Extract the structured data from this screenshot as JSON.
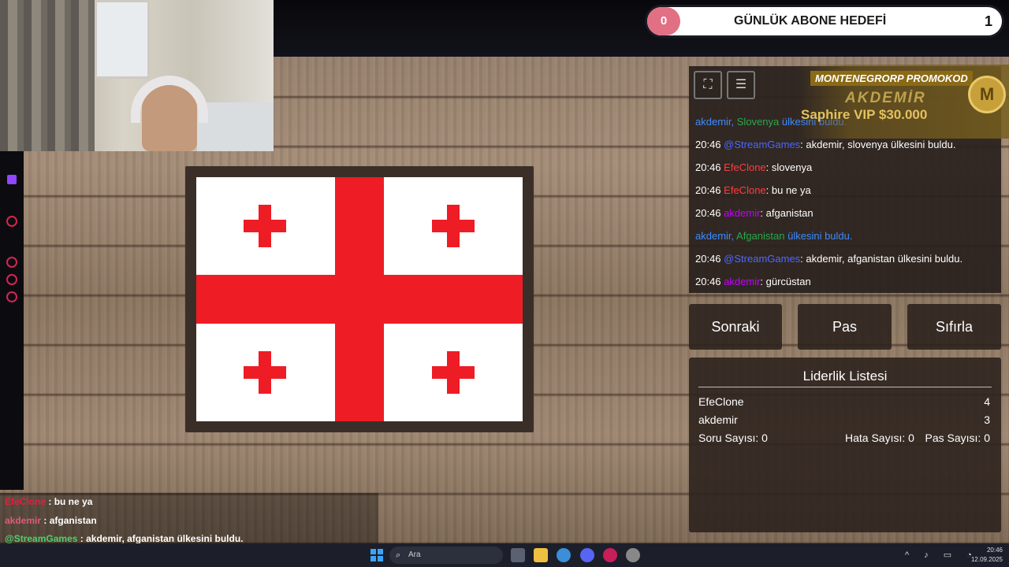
{
  "goal": {
    "count": "0",
    "title": "GÜNLÜK ABONE HEDEFİ",
    "target": "1"
  },
  "promo": {
    "label": "MONTENEGRORP PROMOKOD",
    "code": "AKDEMİR",
    "vip": "Saphire VIP $30.000",
    "badge": "M"
  },
  "chat": {
    "tools": [
      "expand-icon",
      "document-icon"
    ],
    "lines": [
      {
        "time": "",
        "user": "akdemir,",
        "user_color": "blue",
        "country": "Slovenya",
        "msg": "ülkesini buldu."
      },
      {
        "time": "20:46",
        "user": "@StreamGames",
        "user_color": "sg",
        "msg": ": akdemir, slovenya ülkesini buldu."
      },
      {
        "time": "20:46",
        "user": "EfeClone",
        "user_color": "red",
        "msg": ": slovenya"
      },
      {
        "time": "20:46",
        "user": "EfeClone",
        "user_color": "red",
        "msg": ": bu ne ya"
      },
      {
        "time": "20:46",
        "user": "akdemir",
        "user_color": "mag",
        "msg": ": afganistan"
      },
      {
        "time": "",
        "user": "akdemir,",
        "user_color": "blue",
        "country": "Afganistan",
        "msg": "ülkesini buldu."
      },
      {
        "time": "20:46",
        "user": "@StreamGames",
        "user_color": "sg",
        "msg": ": akdemir, afganistan ülkesini buldu."
      },
      {
        "time": "20:46",
        "user": "akdemir",
        "user_color": "mag",
        "msg": ": gürcüstan"
      }
    ]
  },
  "buttons": {
    "next": "Sonraki",
    "pass": "Pas",
    "reset": "Sıfırla"
  },
  "leaderboard": {
    "title": "Liderlik Listesi",
    "entries": [
      {
        "name": "EfeClone",
        "score": "4"
      },
      {
        "name": "akdemir",
        "score": "3"
      }
    ],
    "questions": "Soru Sayısı: 0",
    "errors": "Hata Sayısı: 0",
    "passes": "Pas Sayısı: 0"
  },
  "overlay_chat": [
    {
      "user": "EfeClone",
      "msg": ": bu ne ya"
    },
    {
      "user": "akdemir",
      "msg": ": afganistan"
    },
    {
      "user": "@StreamGames",
      "msg": ": akdemir, afganistan ülkesini buldu."
    }
  ],
  "taskbar": {
    "search_placeholder": "Ara",
    "time": "20:46",
    "date": "12.09.2025"
  },
  "colors": {
    "flag_red": "#ee1c25",
    "flag_white": "#ffffff",
    "accent": "#d6254f"
  }
}
